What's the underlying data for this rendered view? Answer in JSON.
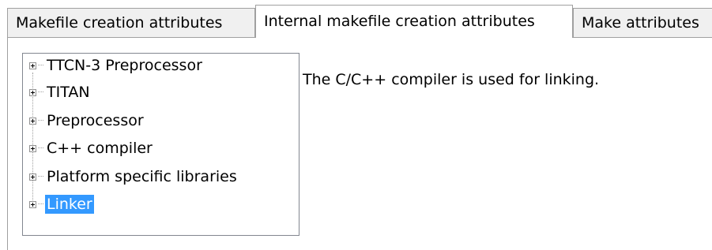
{
  "tabs": [
    {
      "label": "Makefile creation attributes",
      "active": false
    },
    {
      "label": "Internal makefile creation attributes",
      "active": true
    },
    {
      "label": "Make attributes",
      "active": false
    }
  ],
  "tree": {
    "items": [
      {
        "label": "TTCN-3 Preprocessor",
        "selected": false
      },
      {
        "label": "TITAN",
        "selected": false
      },
      {
        "label": "Preprocessor",
        "selected": false
      },
      {
        "label": "C++ compiler",
        "selected": false
      },
      {
        "label": "Platform specific libraries",
        "selected": false
      },
      {
        "label": "Linker",
        "selected": true
      }
    ],
    "expander_icon": "plus-box-icon"
  },
  "details": {
    "message": "The C/C++ compiler is used for linking."
  },
  "colors": {
    "selection": "#3399ff",
    "border": "#a0a0a0"
  }
}
